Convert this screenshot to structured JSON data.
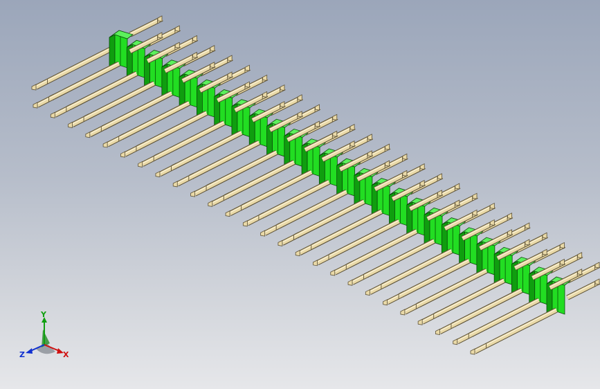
{
  "viewport": {
    "background_top": "#9ba6ba",
    "background_bottom": "#e6e7ea"
  },
  "model": {
    "part": "pin header",
    "rows": 2,
    "pins_per_row": 26,
    "housing_color": "#22dd22",
    "pin_color": "#e9d9a8"
  },
  "triad": {
    "x_label": "X",
    "y_label": "Y",
    "z_label": "Z",
    "x_color": "#d01010",
    "y_color": "#10a010",
    "z_color": "#1030d0"
  }
}
